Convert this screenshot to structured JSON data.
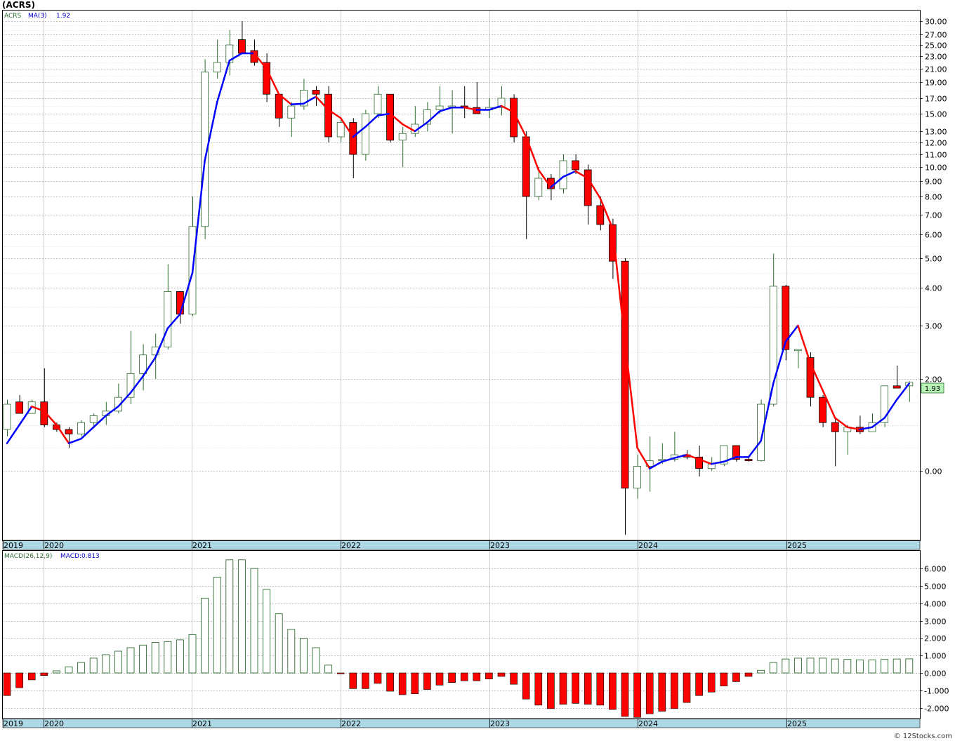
{
  "header": {
    "title": "(ACRS)"
  },
  "legend_price": {
    "symbol": "ACRS",
    "ma_label": "MA(3)",
    "ma_value": "1.92"
  },
  "legend_macd": {
    "label": "MACD(26,12,9)",
    "value_label": "MACD:0.813"
  },
  "last_price_label": "1.93",
  "watermark": "© 12Stocks.com",
  "colors": {
    "up": "#2e6b2e",
    "down": "#ff0000",
    "ma_up": "#0000ff",
    "ma_down": "#ff0000",
    "axis_band": "#add8e6",
    "last_box": "#b6f2b6"
  },
  "chart_data": [
    {
      "type": "candlestick",
      "title": "(ACRS)",
      "x_labels": [
        "2019",
        "2020",
        "2021",
        "2022",
        "2023",
        "2024",
        "2025"
      ],
      "y_ticks": [
        "30.00",
        "27.00",
        "25.00",
        "23.00",
        "21.00",
        "19.00",
        "17.00",
        "15.00",
        "13.00",
        "12.00",
        "11.00",
        "10.00",
        "9.00",
        "8.00",
        "7.00",
        "6.00",
        "5.00",
        "4.00",
        "3.00",
        "2.00",
        "0.00"
      ],
      "candles": [
        {
          "o": 0.9,
          "h": 1.55,
          "l": 0.75,
          "c": 1.45
        },
        {
          "o": 1.5,
          "h": 1.65,
          "l": 1.25,
          "c": 1.25
        },
        {
          "o": 1.25,
          "h": 1.55,
          "l": 1.25,
          "c": 1.5
        },
        {
          "o": 1.5,
          "h": 2.2,
          "l": 0.95,
          "c": 1.0
        },
        {
          "o": 1.0,
          "h": 1.05,
          "l": 0.85,
          "c": 0.9
        },
        {
          "o": 0.9,
          "h": 0.95,
          "l": 0.5,
          "c": 0.8
        },
        {
          "o": 0.8,
          "h": 1.1,
          "l": 0.75,
          "c": 1.05
        },
        {
          "o": 1.05,
          "h": 1.25,
          "l": 0.95,
          "c": 1.2
        },
        {
          "o": 1.2,
          "h": 1.5,
          "l": 1.0,
          "c": 1.3
        },
        {
          "o": 1.3,
          "h": 1.9,
          "l": 1.25,
          "c": 1.6
        },
        {
          "o": 1.6,
          "h": 2.9,
          "l": 1.45,
          "c": 2.1
        },
        {
          "o": 2.1,
          "h": 2.65,
          "l": 1.75,
          "c": 2.45
        },
        {
          "o": 2.45,
          "h": 2.85,
          "l": 2.0,
          "c": 2.6
        },
        {
          "o": 2.6,
          "h": 4.8,
          "l": 2.55,
          "c": 3.9
        },
        {
          "o": 3.9,
          "h": 3.9,
          "l": 3.05,
          "c": 3.3
        },
        {
          "o": 3.3,
          "h": 8.0,
          "l": 3.25,
          "c": 6.4
        },
        {
          "o": 6.4,
          "h": 22.5,
          "l": 5.8,
          "c": 20.5
        },
        {
          "o": 20.5,
          "h": 26.0,
          "l": 19.5,
          "c": 22.0
        },
        {
          "o": 22.0,
          "h": 28.0,
          "l": 20.0,
          "c": 25.0
        },
        {
          "o": 26.0,
          "h": 30.0,
          "l": 23.5,
          "c": 23.5
        },
        {
          "o": 24.0,
          "h": 26.0,
          "l": 21.5,
          "c": 22.0
        },
        {
          "o": 22.0,
          "h": 23.5,
          "l": 16.5,
          "c": 17.5
        },
        {
          "o": 17.5,
          "h": 17.5,
          "l": 13.5,
          "c": 14.5
        },
        {
          "o": 14.5,
          "h": 16.5,
          "l": 12.5,
          "c": 16.0
        },
        {
          "o": 16.0,
          "h": 19.5,
          "l": 15.5,
          "c": 18.0
        },
        {
          "o": 18.0,
          "h": 18.5,
          "l": 16.0,
          "c": 17.5
        },
        {
          "o": 17.5,
          "h": 18.5,
          "l": 12.0,
          "c": 12.5
        },
        {
          "o": 12.5,
          "h": 14.5,
          "l": 12.0,
          "c": 14.0
        },
        {
          "o": 14.0,
          "h": 14.5,
          "l": 9.2,
          "c": 11.0
        },
        {
          "o": 11.0,
          "h": 15.5,
          "l": 10.5,
          "c": 15.0
        },
        {
          "o": 15.0,
          "h": 18.5,
          "l": 14.5,
          "c": 17.5
        },
        {
          "o": 17.5,
          "h": 17.5,
          "l": 12.0,
          "c": 12.2
        },
        {
          "o": 12.2,
          "h": 13.5,
          "l": 10.0,
          "c": 12.8
        },
        {
          "o": 12.8,
          "h": 16.0,
          "l": 12.5,
          "c": 13.8
        },
        {
          "o": 13.8,
          "h": 16.5,
          "l": 13.0,
          "c": 15.5
        },
        {
          "o": 15.5,
          "h": 18.5,
          "l": 15.0,
          "c": 16.0
        },
        {
          "o": 16.0,
          "h": 18.0,
          "l": 12.8,
          "c": 16.0
        },
        {
          "o": 16.0,
          "h": 18.5,
          "l": 14.5,
          "c": 15.8
        },
        {
          "o": 15.8,
          "h": 19.0,
          "l": 15.0,
          "c": 15.0
        },
        {
          "o": 15.5,
          "h": 17.0,
          "l": 14.5,
          "c": 15.8
        },
        {
          "o": 15.8,
          "h": 18.5,
          "l": 14.8,
          "c": 17.0
        },
        {
          "o": 17.0,
          "h": 17.5,
          "l": 12.0,
          "c": 12.5
        },
        {
          "o": 12.5,
          "h": 13.0,
          "l": 5.8,
          "c": 8.0
        },
        {
          "o": 8.0,
          "h": 10.0,
          "l": 7.8,
          "c": 9.2
        },
        {
          "o": 9.2,
          "h": 9.5,
          "l": 7.8,
          "c": 8.5
        },
        {
          "o": 8.5,
          "h": 11.0,
          "l": 8.2,
          "c": 10.5
        },
        {
          "o": 10.5,
          "h": 11.0,
          "l": 9.5,
          "c": 9.8
        },
        {
          "o": 9.8,
          "h": 10.2,
          "l": 6.5,
          "c": 7.5
        },
        {
          "o": 7.5,
          "h": 8.0,
          "l": 6.2,
          "c": 6.5
        },
        {
          "o": 6.5,
          "h": 6.8,
          "l": 4.3,
          "c": 4.9
        },
        {
          "o": 4.9,
          "h": 5.0,
          "l": -0.92,
          "c": -0.25
        },
        {
          "o": -0.25,
          "h": 0.35,
          "l": -0.4,
          "c": 0.1
        },
        {
          "o": 0.1,
          "h": 0.75,
          "l": -0.3,
          "c": 0.22
        },
        {
          "o": 0.22,
          "h": 0.6,
          "l": 0.15,
          "c": 0.25
        },
        {
          "o": 0.25,
          "h": 0.85,
          "l": 0.2,
          "c": 0.35
        },
        {
          "o": 0.35,
          "h": 0.45,
          "l": 0.25,
          "c": 0.3
        },
        {
          "o": 0.3,
          "h": 0.55,
          "l": -0.08,
          "c": 0.05
        },
        {
          "o": 0.05,
          "h": 0.3,
          "l": 0.0,
          "c": 0.15
        },
        {
          "o": 0.15,
          "h": 0.55,
          "l": 0.1,
          "c": 0.55
        },
        {
          "o": 0.55,
          "h": 0.55,
          "l": 0.2,
          "c": 0.25
        },
        {
          "o": 0.25,
          "h": 0.3,
          "l": 0.2,
          "c": 0.22
        },
        {
          "o": 0.22,
          "h": 1.55,
          "l": 0.2,
          "c": 1.45
        },
        {
          "o": 1.45,
          "h": 5.2,
          "l": 1.4,
          "c": 4.05
        },
        {
          "o": 4.05,
          "h": 4.1,
          "l": 2.35,
          "c": 2.55
        },
        {
          "o": 2.55,
          "h": 2.55,
          "l": 2.2,
          "c": 2.55
        },
        {
          "o": 2.4,
          "h": 2.5,
          "l": 1.4,
          "c": 1.6
        },
        {
          "o": 1.6,
          "h": 1.65,
          "l": 0.95,
          "c": 1.05
        },
        {
          "o": 1.05,
          "h": 1.15,
          "l": 0.1,
          "c": 0.85
        },
        {
          "o": 0.85,
          "h": 1.0,
          "l": 0.35,
          "c": 0.95
        },
        {
          "o": 0.95,
          "h": 1.2,
          "l": 0.8,
          "c": 0.85
        },
        {
          "o": 0.85,
          "h": 1.25,
          "l": 0.85,
          "c": 1.05
        },
        {
          "o": 1.05,
          "h": 1.7,
          "l": 0.95,
          "c": 1.85
        },
        {
          "o": 1.85,
          "h": 2.25,
          "l": 1.8,
          "c": 1.8
        },
        {
          "o": 1.85,
          "h": 1.95,
          "l": 1.5,
          "c": 1.93
        }
      ],
      "ma": [
        0.6,
        1.0,
        1.4,
        1.3,
        1.0,
        0.6,
        0.7,
        0.95,
        1.2,
        1.4,
        1.7,
        2.05,
        2.4,
        2.95,
        3.3,
        4.5,
        10.5,
        16.5,
        22.3,
        23.5,
        23.5,
        21.0,
        17.5,
        16.2,
        16.3,
        17.2,
        15.5,
        14.5,
        12.5,
        13.5,
        14.8,
        15.0,
        13.8,
        13.0,
        14.0,
        15.3,
        15.8,
        15.8,
        15.5,
        15.5,
        16.0,
        15.2,
        12.5,
        9.8,
        8.6,
        9.3,
        9.7,
        9.2,
        7.9,
        6.3,
        2.7,
        0.5,
        0.05,
        0.2,
        0.28,
        0.35,
        0.25,
        0.15,
        0.2,
        0.3,
        0.3,
        0.65,
        1.9,
        2.7,
        3.0,
        2.3,
        1.75,
        1.15,
        0.95,
        0.9,
        0.95,
        1.15,
        1.55,
        1.9
      ],
      "ma_label": "MA(3)"
    },
    {
      "type": "bar",
      "title": "MACD(26,12,9)",
      "y_ticks": [
        "6.000",
        "5.000",
        "4.000",
        "3.000",
        "2.000",
        "1.000",
        "0.000",
        "-1.000",
        "-2.000"
      ],
      "x_labels": [
        "2019",
        "2020",
        "2021",
        "2022",
        "2023",
        "2024",
        "2025"
      ],
      "values": [
        -1.3,
        -0.85,
        -0.4,
        -0.15,
        0.12,
        0.35,
        0.6,
        0.85,
        1.05,
        1.25,
        1.45,
        1.6,
        1.75,
        1.8,
        1.9,
        2.2,
        4.3,
        5.5,
        6.5,
        6.5,
        6.0,
        4.8,
        3.4,
        2.5,
        2.0,
        1.45,
        0.45,
        -0.05,
        -0.9,
        -0.9,
        -0.6,
        -1.05,
        -1.25,
        -1.2,
        -0.95,
        -0.7,
        -0.55,
        -0.45,
        -0.45,
        -0.35,
        -0.2,
        -0.65,
        -1.5,
        -1.85,
        -2.05,
        -1.8,
        -1.75,
        -1.8,
        -1.85,
        -2.1,
        -2.5,
        -2.55,
        -2.35,
        -2.2,
        -2.05,
        -1.7,
        -1.3,
        -1.1,
        -0.75,
        -0.5,
        -0.2,
        0.15,
        0.6,
        0.8,
        0.85,
        0.85,
        0.85,
        0.8,
        0.78,
        0.75,
        0.75,
        0.78,
        0.8,
        0.81
      ]
    }
  ]
}
